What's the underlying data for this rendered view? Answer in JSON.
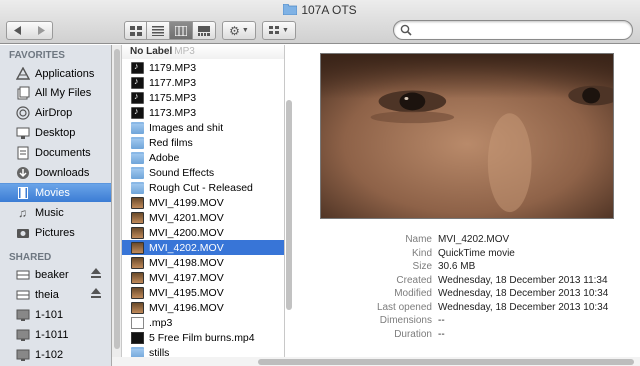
{
  "window": {
    "title": "107A OTS",
    "title_icon": "folder-icon"
  },
  "toolbar": {
    "back_icon": "back-arrow-icon",
    "forward_icon": "forward-arrow-icon",
    "view_modes": [
      "icon-view",
      "list-view",
      "column-view",
      "cover-flow-view"
    ],
    "active_view": "column-view",
    "action_icon": "gear-icon",
    "arrange_icon": "arrange-grid-icon",
    "search_placeholder": ""
  },
  "sidebar": {
    "favorites_header": "FAVORITES",
    "favorites": [
      {
        "label": "Applications",
        "icon": "applications-icon",
        "selected": false
      },
      {
        "label": "All My Files",
        "icon": "all-my-files-icon",
        "selected": false
      },
      {
        "label": "AirDrop",
        "icon": "airdrop-icon",
        "selected": false
      },
      {
        "label": "Desktop",
        "icon": "desktop-icon",
        "selected": false
      },
      {
        "label": "Documents",
        "icon": "documents-icon",
        "selected": false
      },
      {
        "label": "Downloads",
        "icon": "downloads-icon",
        "selected": false
      },
      {
        "label": "Movies",
        "icon": "movies-icon",
        "selected": true
      },
      {
        "label": "Music",
        "icon": "music-icon",
        "selected": false
      },
      {
        "label": "Pictures",
        "icon": "pictures-icon",
        "selected": false
      }
    ],
    "shared_header": "SHARED",
    "shared": [
      {
        "label": "beaker",
        "icon": "server-icon",
        "eject": true
      },
      {
        "label": "theia",
        "icon": "server-icon",
        "eject": true
      },
      {
        "label": "1-101",
        "icon": "display-icon",
        "eject": false
      },
      {
        "label": "1-1011",
        "icon": "display-icon",
        "eject": false
      },
      {
        "label": "1-102",
        "icon": "display-icon",
        "eject": false
      }
    ]
  },
  "column": {
    "header_label": "No Label",
    "header_underlay": "MP3",
    "files": [
      {
        "name": "1179.MP3",
        "icon": "audio-file-icon",
        "selected": false
      },
      {
        "name": "1177.MP3",
        "icon": "audio-file-icon",
        "selected": false
      },
      {
        "name": "1175.MP3",
        "icon": "audio-file-icon",
        "selected": false
      },
      {
        "name": "1173.MP3",
        "icon": "audio-file-icon",
        "selected": false
      },
      {
        "name": "Images and shit",
        "icon": "folder-icon",
        "selected": false
      },
      {
        "name": "Red films",
        "icon": "folder-icon",
        "selected": false
      },
      {
        "name": "Adobe",
        "icon": "folder-icon",
        "selected": false
      },
      {
        "name": "Sound Effects",
        "icon": "folder-icon",
        "selected": false
      },
      {
        "name": "Rough Cut - Released",
        "icon": "folder-icon",
        "selected": false
      },
      {
        "name": "MVI_4199.MOV",
        "icon": "video-file-icon",
        "selected": false
      },
      {
        "name": "MVI_4201.MOV",
        "icon": "video-file-icon",
        "selected": false
      },
      {
        "name": "MVI_4200.MOV",
        "icon": "video-file-icon",
        "selected": false
      },
      {
        "name": "MVI_4202.MOV",
        "icon": "video-file-icon",
        "selected": true
      },
      {
        "name": "MVI_4198.MOV",
        "icon": "video-file-icon",
        "selected": false
      },
      {
        "name": "MVI_4197.MOV",
        "icon": "video-file-icon",
        "selected": false
      },
      {
        "name": "MVI_4195.MOV",
        "icon": "video-file-icon",
        "selected": false
      },
      {
        "name": "MVI_4196.MOV",
        "icon": "video-file-icon",
        "selected": false
      },
      {
        "name": ".mp3",
        "icon": "blank-file-icon",
        "selected": false
      },
      {
        "name": "5 Free Film burns.mp4",
        "icon": "film-file-icon",
        "selected": false
      },
      {
        "name": "stills",
        "icon": "folder-icon",
        "selected": false
      }
    ]
  },
  "preview": {
    "thumbnail": "video-thumbnail-face",
    "info": [
      {
        "key": "Name",
        "value": "MVI_4202.MOV"
      },
      {
        "key": "Kind",
        "value": "QuickTime movie"
      },
      {
        "key": "Size",
        "value": "30.6 MB"
      },
      {
        "key": "Created",
        "value": "Wednesday, 18 December 2013 11:34"
      },
      {
        "key": "Modified",
        "value": "Wednesday, 18 December 2013 10:34"
      },
      {
        "key": "Last opened",
        "value": "Wednesday, 18 December 2013 10:34"
      },
      {
        "key": "Dimensions",
        "value": "--"
      },
      {
        "key": "Duration",
        "value": "--"
      }
    ]
  },
  "colors": {
    "selection": "#3875d7",
    "sidebar_bg": "#dfe3e9",
    "sidebar_selected": "#3b7cd4"
  }
}
